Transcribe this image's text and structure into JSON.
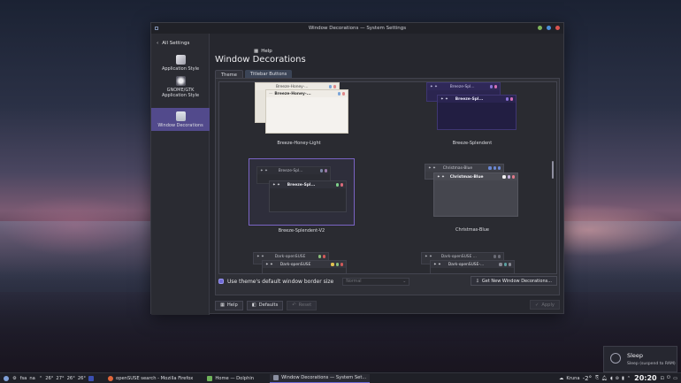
{
  "window": {
    "title": "Window Decorations — System Settings"
  },
  "header": {
    "back_label": "All Settings",
    "help_label": "Help"
  },
  "sidebar": {
    "items": [
      {
        "label": "Application Style"
      },
      {
        "label": "GNOME/GTK Application Style"
      },
      {
        "label": "Window Decorations"
      }
    ]
  },
  "main": {
    "title": "Window Decorations",
    "tabs": [
      {
        "label": "Theme"
      },
      {
        "label": "Titlebar Buttons"
      }
    ],
    "themes": [
      {
        "name": "Breeze-Honey-Light",
        "preview_back": "Breeze-Honey-...",
        "preview_front": "Breeze-Honey-..."
      },
      {
        "name": "Breeze-Splendent",
        "preview_back": "Breeze-Spl...",
        "preview_front": "Breeze-Spl..."
      },
      {
        "name": "Breeze-Splendent-V2",
        "preview_back": "Breeze-Spl...",
        "preview_front": "Breeze-Spl..."
      },
      {
        "name": "Christmas-Blue",
        "preview_back": "Christmas-Blue",
        "preview_front": "Christmas-Blue"
      },
      {
        "name": "Dark-openSUSE",
        "preview_back": "Dark-openSUSE",
        "preview_front": "Dark-openSUSE"
      },
      {
        "name": "Dark-openSUSE-...",
        "preview_back": "Dark-openSUSE ...",
        "preview_front": "Dark-openSUSE-..."
      }
    ],
    "border_checkbox_label": "Use theme's default window border size",
    "border_select_value": "Normal",
    "get_new_label": "Get New Window Decorations..."
  },
  "footer": {
    "help": "Help",
    "defaults": "Defaults",
    "reset": "Reset",
    "apply": "Apply"
  },
  "notification": {
    "title": "Sleep",
    "body": "Sleep (suspend to RAM)"
  },
  "taskbar": {
    "lang": "fsa",
    "lang2": "na",
    "temps": [
      "26°",
      "27°",
      "26°",
      "26°"
    ],
    "apps": [
      {
        "label": "openSUSE search - Mozilla Firefox"
      },
      {
        "label": "Home — Dolphin"
      },
      {
        "label": "Window Decorations — System Set..."
      }
    ],
    "weather_place": "Kruna",
    "weather_temp": "-2°",
    "clock": "20:20"
  }
}
